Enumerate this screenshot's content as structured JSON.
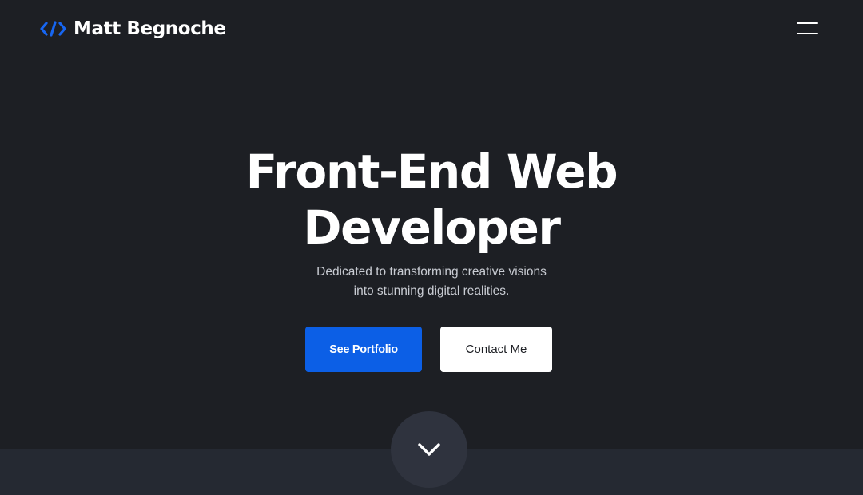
{
  "header": {
    "logo_icon": "code-brackets-icon",
    "logo_text": "Matt Begnoche",
    "menu_icon": "hamburger-menu-icon"
  },
  "hero": {
    "title_line1": "Front-End Web",
    "title_line2": "Developer",
    "subtitle_line1": "Dedicated to transforming creative visions",
    "subtitle_line2": "into stunning digital realities.",
    "primary_button": "See Portfolio",
    "secondary_button": "Contact Me",
    "scroll_icon": "chevron-down-icon"
  },
  "colors": {
    "background": "#1d1f24",
    "accent": "#0c5fe6",
    "bottom_band": "#252932",
    "scroll_circle": "#2f333e"
  }
}
